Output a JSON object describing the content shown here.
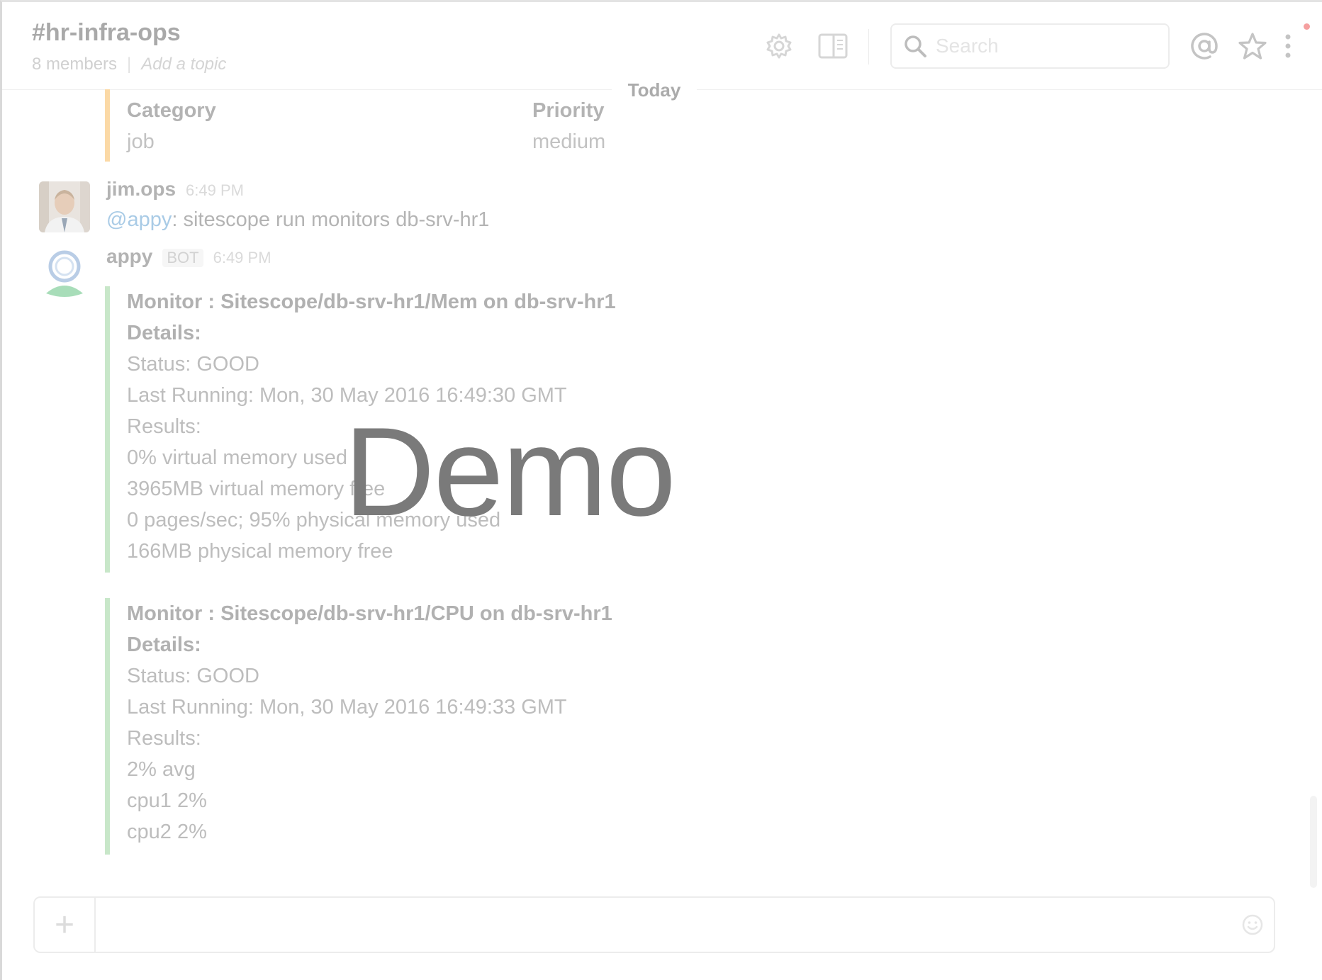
{
  "channel": {
    "name": "#hr-infra-ops",
    "members": "8 members",
    "topic_link": "Add a topic"
  },
  "search": {
    "placeholder": "Search"
  },
  "day_divider": "Today",
  "previous_attachment": {
    "fields": [
      {
        "title": "Category",
        "value": "job"
      },
      {
        "title": "Priority",
        "value": "medium"
      }
    ]
  },
  "messages": [
    {
      "author": "jim.ops",
      "time": "6:49 PM",
      "mention": "@appy",
      "text": ": sitescope run monitors db-srv-hr1"
    },
    {
      "author": "appy",
      "badge": "BOT",
      "time": "6:49 PM",
      "attachments": [
        {
          "lines": [
            "Monitor : Sitescope/db-srv-hr1/Mem on db-srv-hr1",
            "Details:",
            "Status: GOOD",
            "Last Running: Mon, 30 May 2016 16:49:30 GMT",
            "Results:",
            "0% virtual memory used",
            "3965MB virtual memory free",
            "0 pages/sec; 95% physical memory used",
            "166MB physical memory free"
          ]
        },
        {
          "lines": [
            "Monitor : Sitescope/db-srv-hr1/CPU on db-srv-hr1",
            "Details:",
            "Status: GOOD",
            "Last Running: Mon, 30 May 2016 16:49:33 GMT",
            "Results:",
            "2% avg",
            "cpu1 2%",
            "cpu2 2%"
          ]
        }
      ]
    }
  ],
  "composer": {
    "plus": "+"
  },
  "watermark": "Demo",
  "icons": [
    "gear-icon",
    "sidebar-toggle-icon",
    "search-icon",
    "at-mention-icon",
    "star-icon",
    "more-vertical-icon",
    "emoji-icon",
    "plus-icon"
  ],
  "colors": {
    "attachment_green": "#c8e7c9",
    "attachment_orange": "#fbd9a6",
    "mention_blue": "#a9cbe6"
  }
}
